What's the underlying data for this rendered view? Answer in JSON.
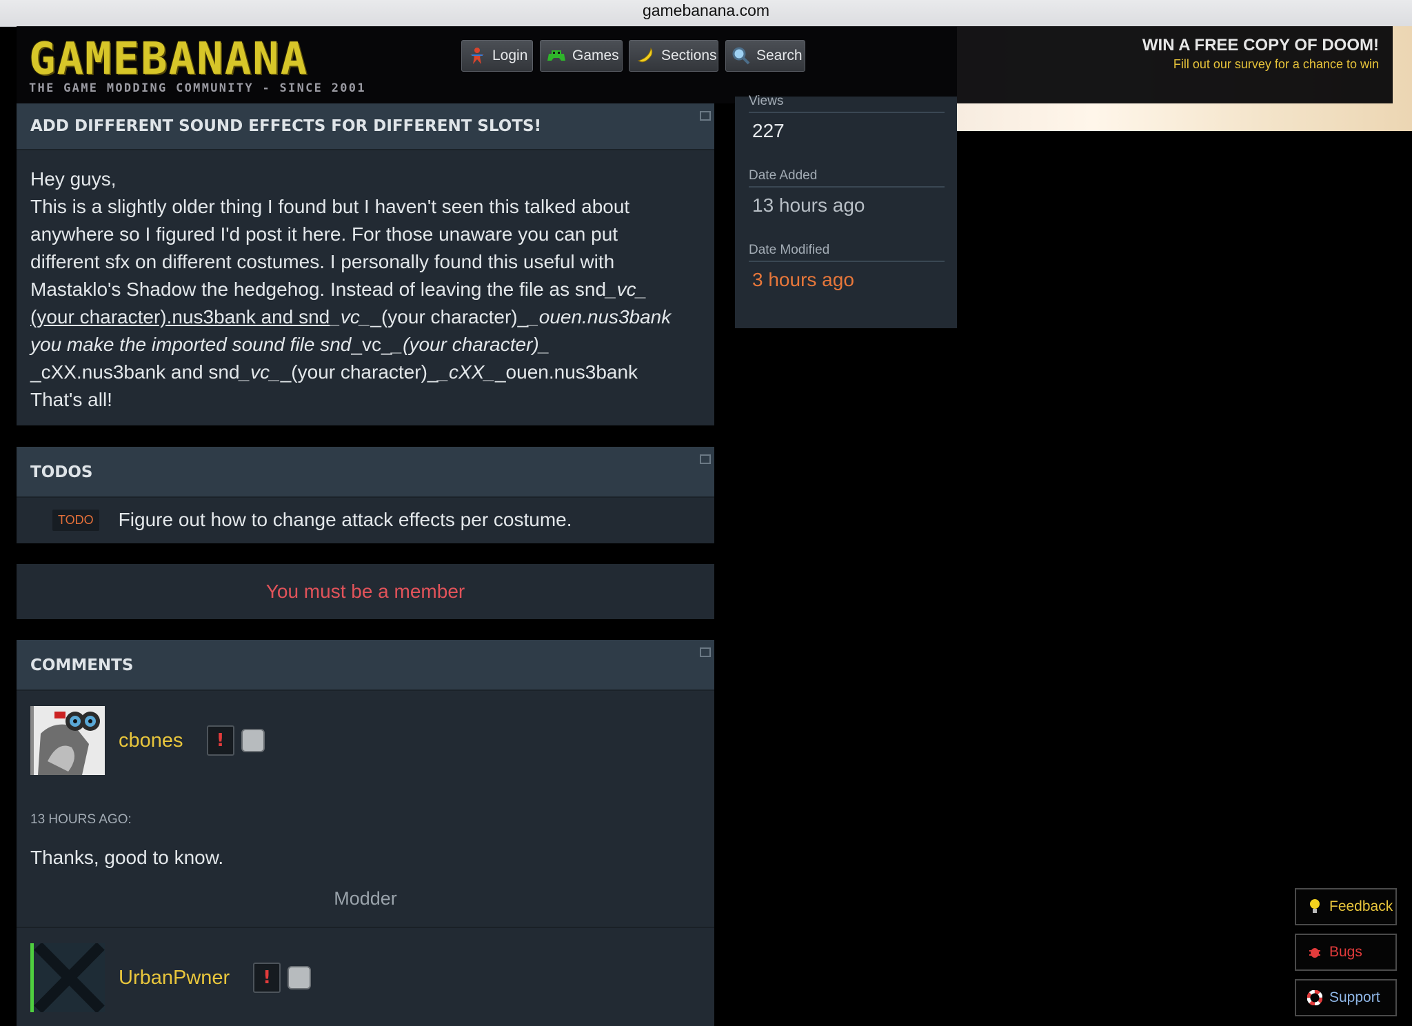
{
  "browser": {
    "url": "gamebanana.com"
  },
  "header": {
    "logo_title": "GAMEBANANA",
    "logo_tagline": "THE GAME MODDING COMMUNITY - SINCE 2001",
    "nav": [
      {
        "label": "Login",
        "icon": "login-icon"
      },
      {
        "label": "Games",
        "icon": "games-icon"
      },
      {
        "label": "Sections",
        "icon": "banana-icon"
      },
      {
        "label": "Search",
        "icon": "search-icon"
      }
    ],
    "promo_title": "WIN A FREE COPY OF DOOM!",
    "promo_subtitle": "Fill out our survey for a chance to win"
  },
  "description": {
    "title": "ADD DIFFERENT SOUND EFFECTS FOR DIFFERENT SLOTS!",
    "line1": "Hey guys,",
    "line2": "This is a slightly older thing I found but I haven't seen this talked about",
    "line3": "anywhere so I figured I'd post it here. For those unaware you can put",
    "line4": "different sfx on different costumes.  I personally found this useful with",
    "line5a": "Mastaklo's Shadow the hedgehog. Instead of leaving the file as snd",
    "line5b": "_vc_",
    "line6a": "(your character).nus3bank and snd",
    "line6b": "_vc_",
    "line6c": "_(your character)_",
    "line6d": "_ouen.nus3bank",
    "line7a": "you make the imported sound file snd",
    "line7b": "_vc_",
    "line7c": "_(your character)_",
    "line8a": "_cXX.nus3bank and snd",
    "line8b": "_vc_",
    "line8c": "_(your character)_",
    "line8d": "_cXX_",
    "line8e": "_ouen.nus3bank",
    "line9": "That's all!"
  },
  "stats": {
    "views_label": "Views",
    "views_value": "227",
    "date_added_label": "Date Added",
    "date_added_value": "13 hours ago",
    "date_modified_label": "Date Modified",
    "date_modified_value": "3 hours ago"
  },
  "todos": {
    "title": "TODOS",
    "badge": "TODO",
    "item": "Figure out how to change attack effects per costume."
  },
  "member_notice": "You must be a member",
  "comments": {
    "title": "COMMENTS",
    "items": [
      {
        "username": "cbones",
        "warn_mark": "!",
        "time": "13 HOURS AGO:",
        "body": "Thanks, good to know.",
        "role": "Modder"
      },
      {
        "username": "UrbanPwner",
        "warn_mark": "!"
      }
    ]
  },
  "floating": {
    "feedback": "Feedback",
    "bugs": "Bugs",
    "support": "Support"
  },
  "colors": {
    "panel": "#222a33",
    "panel_header": "#2f3c48",
    "username": "#e9c63c",
    "accent_orange": "#e8773a",
    "member_red": "#e2535a"
  }
}
